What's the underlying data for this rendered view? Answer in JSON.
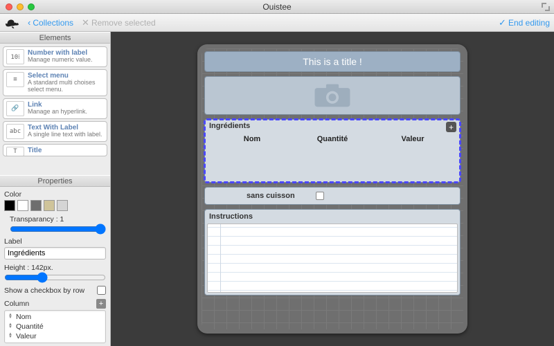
{
  "window": {
    "title": "Ouistee"
  },
  "toolbar": {
    "collections": "Collections",
    "remove": "Remove selected",
    "end": "End editing"
  },
  "sidebar": {
    "elements_header": "Elements",
    "properties_header": "Properties",
    "elements": [
      {
        "title": "Number with label",
        "desc": "Manage numeric value.",
        "icon": "10⁞"
      },
      {
        "title": "Select menu",
        "desc": "A standard multi choises select menu.",
        "icon": "≡"
      },
      {
        "title": "Link",
        "desc": "Manage an hyperlink.",
        "icon": "🔗"
      },
      {
        "title": "Text With Label",
        "desc": "A single line text with label.",
        "icon": "abc"
      },
      {
        "title": "Title",
        "desc": "",
        "icon": "T"
      }
    ]
  },
  "properties": {
    "color_label": "Color",
    "transparency_label": "Transparancy : 1",
    "label_label": "Label",
    "label_value": "Ingrédients",
    "height_label": "Height : 142px.",
    "show_cb_label": "Show a checkbox by row",
    "column_label": "Column",
    "columns": [
      "Nom",
      "Quantité",
      "Valeur"
    ]
  },
  "card": {
    "title": "This is a title !",
    "table_label": "Ingrédients",
    "table_cols": [
      "Nom",
      "Quantité",
      "Valeur"
    ],
    "checkbox_label": "sans cuisson",
    "instructions_label": "Instructions"
  }
}
